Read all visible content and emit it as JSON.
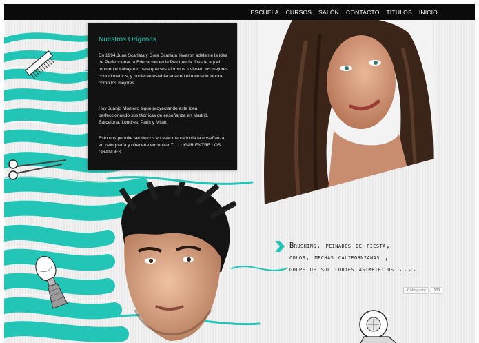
{
  "nav": {
    "items": [
      "ESCUELA",
      "CURSOS",
      "SALÓN",
      "CONTACTO",
      "TÍTULOS",
      "INICIO"
    ]
  },
  "about": {
    "title": "Nuestros Orígenes",
    "paragraph1": "En 1994 Juan Scarlata y Dora Scarlata llevaron adelante la idea de Perfeccionar la Educación en la Peluquería. Desde aquel momento trabajaron para que sus alumnos tuviesen los mejores conocimientos, y pudieran establecerse en el mercado laboral como los mejores.",
    "paragraph2": "Hoy Juanjo Montero sigue proyectando esta idea perfeccionando sus técnicas de enseñanza en Madrid, Barcelona, Londres, Paris y Milán.",
    "paragraph3": "Esto nos permite ser únicos en este mercado de la enseñanza en peluquería y ofrecerte encontrar TU LUGAR ENTRE LOS GRANDES."
  },
  "tagline": {
    "line1": "Brushing, peinados de fiesta,",
    "line2": "color, mechas californianas ,",
    "line3": "golpe de sol cortes asimetricos ...."
  },
  "like": {
    "label": "✔ Me gusta",
    "count": "880"
  },
  "colors": {
    "accent": "#23c6b6",
    "topbar": "#0b0b0b",
    "box": "#121212"
  },
  "icons": [
    "comb-icon",
    "scissors-icon",
    "shaving-brush-icon",
    "hair-dryer-icon",
    "chevron-right-icon"
  ]
}
